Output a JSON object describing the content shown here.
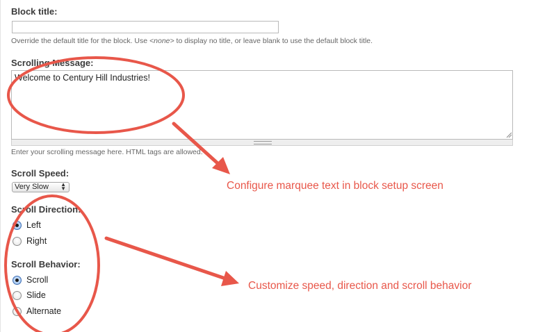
{
  "block_title": {
    "label": "Block title:",
    "value": "",
    "description_before": "Override the default title for the block. Use ",
    "description_em": "<none>",
    "description_after": " to display no title, or leave blank to use the default block title."
  },
  "scrolling_message": {
    "label": "Scrolling Message:",
    "value": "Welcome to Century Hill Industries!",
    "description": "Enter your scrolling message here. HTML tags are allowed."
  },
  "scroll_speed": {
    "label": "Scroll Speed:",
    "selected": "Very Slow"
  },
  "scroll_direction": {
    "label": "Scroll Direction:",
    "options": [
      {
        "label": "Left",
        "checked": true
      },
      {
        "label": "Right",
        "checked": false
      }
    ]
  },
  "scroll_behavior": {
    "label": "Scroll Behavior:",
    "options": [
      {
        "label": "Scroll",
        "checked": true
      },
      {
        "label": "Slide",
        "checked": false
      },
      {
        "label": "Alternate",
        "checked": false
      }
    ]
  },
  "annotations": {
    "marquee_text": "Configure marquee text in block setup screen",
    "speed_direction": "Customize speed, direction and scroll behavior",
    "color": "#e8574a"
  }
}
